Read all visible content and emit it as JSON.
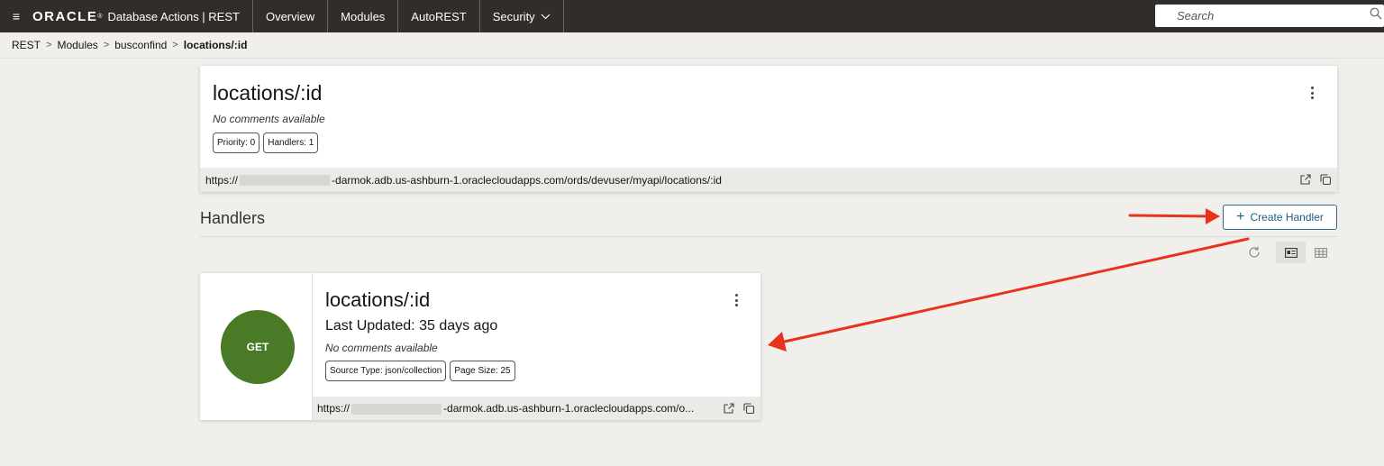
{
  "topbar": {
    "logo_text": "ORACLE",
    "logo_mark": "®",
    "app_name": "Database Actions | REST",
    "tabs": [
      {
        "label": "Overview"
      },
      {
        "label": "Modules"
      },
      {
        "label": "AutoREST"
      },
      {
        "label": "Security",
        "has_chevron": true
      }
    ],
    "search_placeholder": "Search"
  },
  "breadcrumb": {
    "items": [
      "REST",
      "Modules",
      "busconfind"
    ],
    "current": "locations/:id"
  },
  "template": {
    "title": "locations/:id",
    "comment": "No comments available",
    "badges": [
      "Priority: 0",
      "Handlers: 1"
    ],
    "url_prefix": "https://",
    "url_suffix": "-darmok.adb.us-ashburn-1.oraclecloudapps.com/ords/devuser/myapi/locations/:id"
  },
  "handlers": {
    "section_title": "Handlers",
    "create_button_label": "Create Handler",
    "cards": [
      {
        "method": "GET",
        "title": "locations/:id",
        "last_updated": "Last Updated: 35 days ago",
        "comment": "No comments available",
        "badges": [
          "Source Type: json/collection",
          "Page Size: 25"
        ],
        "url_prefix": "https://",
        "url_suffix": "-darmok.adb.us-ashburn-1.oraclecloudapps.com/o..."
      }
    ]
  },
  "colors": {
    "topbar_bg": "#312d2a",
    "get_method": "#4b7a27",
    "accent_button": "#1b5e80",
    "annotation_arrow": "#e8321c"
  },
  "icons": [
    "hamburger-icon",
    "search-icon",
    "kebab-menu-icon",
    "open-external-icon",
    "copy-icon",
    "refresh-icon",
    "card-view-icon",
    "table-view-icon",
    "chevron-down-icon"
  ]
}
